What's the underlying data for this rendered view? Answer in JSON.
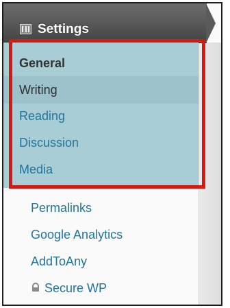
{
  "header": {
    "title": "Settings",
    "icon": "settings-icon"
  },
  "submenu": {
    "items": [
      {
        "label": "General",
        "state": "current"
      },
      {
        "label": "Writing",
        "state": "hover"
      },
      {
        "label": "Reading",
        "state": "link"
      },
      {
        "label": "Discussion",
        "state": "link"
      },
      {
        "label": "Media",
        "state": "link"
      }
    ]
  },
  "more_items": [
    {
      "label": "Permalinks"
    },
    {
      "label": "Google Analytics"
    },
    {
      "label": "AddToAny"
    },
    {
      "label": "Secure WP",
      "icon": "lock-icon"
    }
  ],
  "colors": {
    "header": "#555555",
    "submenu_bg": "#a8cdd5",
    "link": "#21759b",
    "highlight": "#d51a12"
  }
}
